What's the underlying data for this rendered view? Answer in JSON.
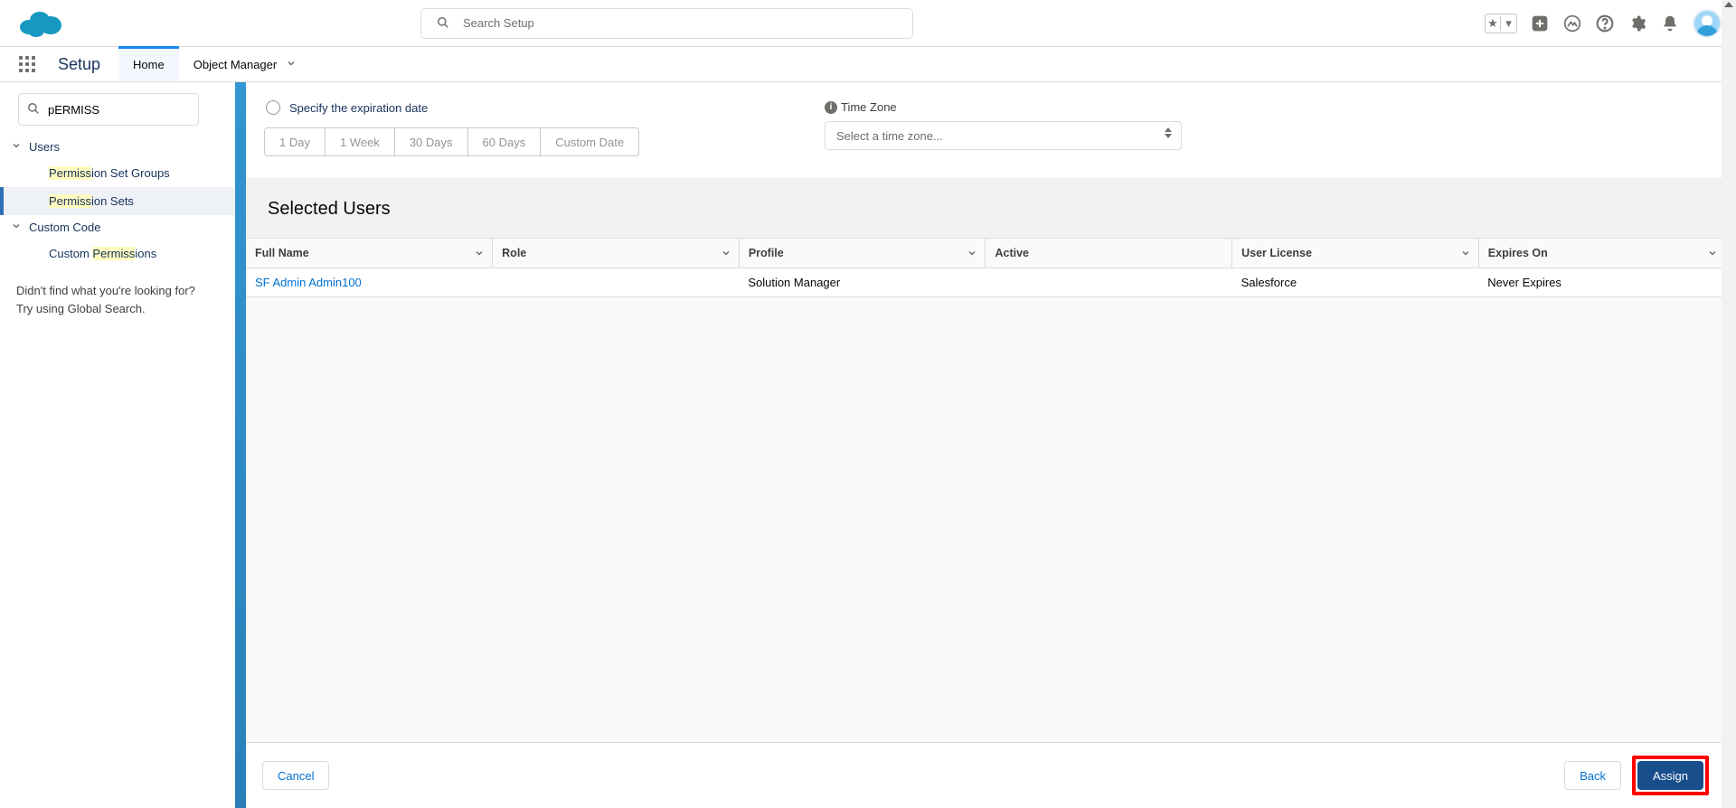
{
  "header": {
    "search_placeholder": "Search Setup",
    "app_name": "Setup",
    "tabs": {
      "home": "Home",
      "object_manager": "Object Manager"
    }
  },
  "sidebar": {
    "search_value": "pERMISS",
    "users_label": "Users",
    "items": {
      "perm_set_groups_pre": "Permiss",
      "perm_set_groups_post": "ion Set Groups",
      "perm_sets_pre": "Permiss",
      "perm_sets_post": "ion Sets"
    },
    "custom_code_label": "Custom Code",
    "custom_perm_pre": "Custom ",
    "custom_perm_hl": "Permiss",
    "custom_perm_post": "ions",
    "help1": "Didn't find what you're looking for?",
    "help2": "Try using Global Search."
  },
  "main": {
    "expiration_label": "Specify the expiration date",
    "durations": [
      "1 Day",
      "1 Week",
      "30 Days",
      "60 Days",
      "Custom Date"
    ],
    "timezone_label": "Time Zone",
    "timezone_placeholder": "Select a time zone...",
    "table_title": "Selected Users",
    "columns": [
      "Full Name",
      "Role",
      "Profile",
      "Active",
      "User License",
      "Expires On"
    ],
    "rows": [
      {
        "full_name": "SF Admin Admin100",
        "role": "",
        "profile": "Solution Manager",
        "active": "",
        "license": "Salesforce",
        "expires": "Never Expires"
      }
    ],
    "buttons": {
      "cancel": "Cancel",
      "back": "Back",
      "assign": "Assign"
    }
  }
}
